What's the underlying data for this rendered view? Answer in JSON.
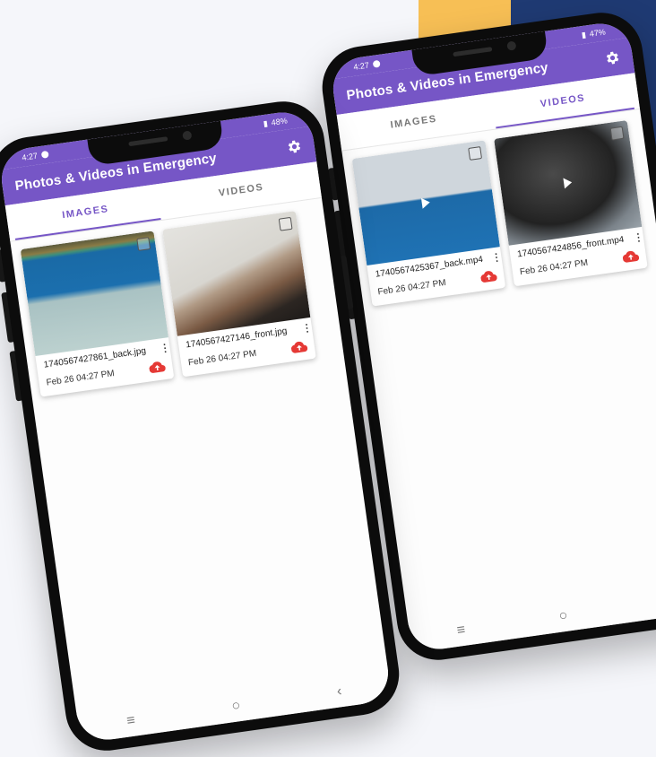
{
  "colors": {
    "primary": "#7656c6",
    "accent_upload": "#e53935",
    "deco_yellow": "#f7bf55",
    "deco_navy": "#1f3a73"
  },
  "phone_left": {
    "status": {
      "time": "4:27",
      "battery": "48%"
    },
    "app_title": "Photos & Videos in Emergency",
    "tabs": [
      {
        "label": "IMAGES",
        "active": true
      },
      {
        "label": "VIDEOS",
        "active": false
      }
    ],
    "items": [
      {
        "name": "1740567427861_back.jpg",
        "date": "Feb 26  04:27 PM",
        "icon": "upload-icon"
      },
      {
        "name": "1740567427146_front.jpg",
        "date": "Feb 26  04:27 PM",
        "icon": "upload-icon"
      }
    ],
    "nav": {
      "menu": "≡",
      "home": "○",
      "back": "‹"
    }
  },
  "phone_right": {
    "status": {
      "time": "4:27",
      "battery": "47%"
    },
    "app_title": "Photos & Videos in Emergency",
    "tabs": [
      {
        "label": "IMAGES",
        "active": false
      },
      {
        "label": "VIDEOS",
        "active": true
      }
    ],
    "items": [
      {
        "name": "1740567425367_back.mp4",
        "date": "Feb 26  04:27 PM",
        "icon": "upload-icon"
      },
      {
        "name": "1740567424856_front.mp4",
        "date": "Feb 26  04:27 PM",
        "icon": "upload-icon"
      }
    ],
    "nav": {
      "menu": "≡",
      "home": "○"
    }
  }
}
